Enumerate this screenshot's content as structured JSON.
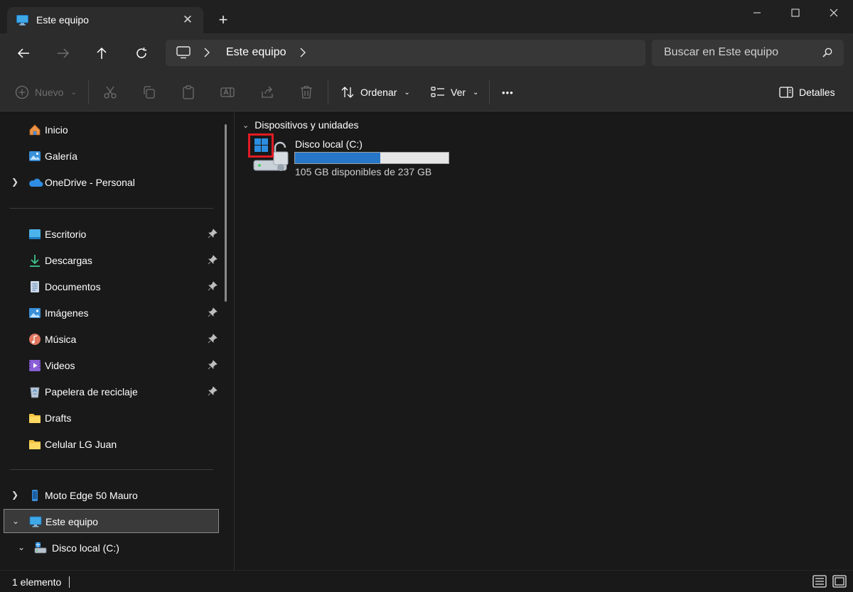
{
  "window": {
    "tab_title": "Este equipo",
    "tab_icon": "monitor-icon",
    "close_tab_glyph": "✕",
    "new_tab_glyph": "+"
  },
  "navigation": {
    "breadcrumb": [
      "Este equipo"
    ],
    "search_placeholder": "Buscar en Este equipo"
  },
  "commands": {
    "new_label": "Nuevo",
    "sort_label": "Ordenar",
    "view_label": "Ver",
    "more_glyph": "•••",
    "details_label": "Detalles"
  },
  "sidebar": {
    "top_items": [
      {
        "label": "Inicio",
        "icon": "home-icon"
      },
      {
        "label": "Galería",
        "icon": "gallery-icon"
      },
      {
        "label": "OneDrive - Personal",
        "icon": "cloud-icon"
      }
    ],
    "pinned_items": [
      {
        "label": "Escritorio",
        "icon": "desktop-icon"
      },
      {
        "label": "Descargas",
        "icon": "download-icon"
      },
      {
        "label": "Documentos",
        "icon": "document-icon"
      },
      {
        "label": "Imágenes",
        "icon": "pictures-icon"
      },
      {
        "label": "Música",
        "icon": "music-icon"
      },
      {
        "label": "Videos",
        "icon": "videos-icon"
      },
      {
        "label": "Papelera de reciclaje",
        "icon": "recycle-bin-icon"
      },
      {
        "label": "Drafts",
        "icon": "folder-icon"
      },
      {
        "label": "Celular LG Juan",
        "icon": "folder-icon"
      }
    ],
    "device_items": [
      {
        "label": "Moto Edge 50 Mauro",
        "icon": "phone-icon"
      },
      {
        "label": "Este equipo",
        "icon": "monitor-icon",
        "selected": true
      },
      {
        "label": "Disco local (C:)",
        "icon": "drive-icon"
      }
    ]
  },
  "main": {
    "group_title": "Dispositivos y unidades",
    "drives": [
      {
        "name": "Disco local (C:)",
        "space_text": "105 GB disponibles de 237 GB",
        "used_fraction": 0.557,
        "bar_color": "#2677c8"
      }
    ]
  },
  "status": {
    "item_count": "1 elemento"
  },
  "colors": {
    "accent": "#2677c8",
    "highlight": "#e01b24",
    "background": "#191919",
    "toolbar": "#2c2c2c"
  }
}
